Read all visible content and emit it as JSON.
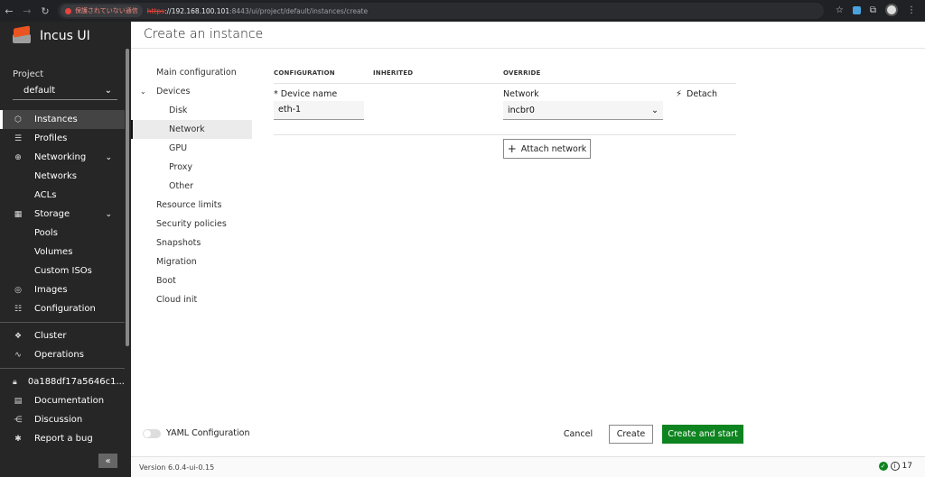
{
  "browser": {
    "warning": "保護されていない通信",
    "url_scheme": "https",
    "url_host": "://192.168.100.101",
    "url_rest": ":8443/ui/project/default/instances/create"
  },
  "sidebar": {
    "brand": "Incus UI",
    "project_label": "Project",
    "project_value": "default",
    "items": [
      {
        "label": "Instances",
        "icon": "instances-icon"
      },
      {
        "label": "Profiles",
        "icon": "profiles-icon"
      },
      {
        "label": "Networking",
        "icon": "networking-icon"
      },
      {
        "label": "Networks"
      },
      {
        "label": "ACLs"
      },
      {
        "label": "Storage",
        "icon": "storage-icon"
      },
      {
        "label": "Pools"
      },
      {
        "label": "Volumes"
      },
      {
        "label": "Custom ISOs"
      },
      {
        "label": "Images",
        "icon": "images-icon"
      },
      {
        "label": "Configuration",
        "icon": "configuration-icon"
      },
      {
        "label": "Cluster",
        "icon": "cluster-icon"
      },
      {
        "label": "Operations",
        "icon": "operations-icon"
      },
      {
        "label": "0a188df17a5646c1...",
        "icon": "lock-icon"
      },
      {
        "label": "Documentation",
        "icon": "documentation-icon"
      },
      {
        "label": "Discussion",
        "icon": "discussion-icon"
      },
      {
        "label": "Report a bug",
        "icon": "bug-icon"
      }
    ]
  },
  "main": {
    "title": "Create an instance",
    "subnav": [
      "Main configuration",
      "Devices",
      "Disk",
      "Network",
      "GPU",
      "Proxy",
      "Other",
      "Resource limits",
      "Security policies",
      "Snapshots",
      "Migration",
      "Boot",
      "Cloud init"
    ],
    "columns": {
      "configuration": "CONFIGURATION",
      "inherited": "INHERITED",
      "override": "OVERRIDE"
    },
    "device_name_label": "* Device name",
    "device_name_value": "eth-1",
    "network_label": "Network",
    "network_value": "incbr0",
    "detach_label": "Detach",
    "attach_label": "Attach network",
    "yaml_label": "YAML Configuration",
    "yaml_enabled": false,
    "cancel_label": "Cancel",
    "create_label": "Create",
    "create_start_label": "Create and start"
  },
  "footer": {
    "version": "Version 6.0.4-ui-0.15",
    "count": "17"
  },
  "colors": {
    "sidebar_bg": "#262626",
    "primary_button": "#0e8420",
    "brand_orange": "#e95420"
  }
}
